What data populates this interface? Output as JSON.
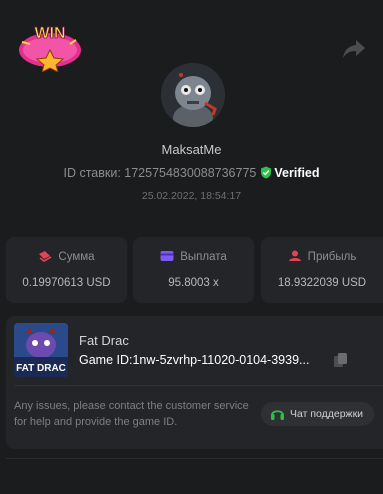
{
  "badge": {
    "text": "WIN"
  },
  "user": {
    "name": "MaksatMe"
  },
  "bet": {
    "id_label": "ID ставки: 1725754830088736775",
    "verified_label": "Verified",
    "datetime": "25.02.2022, 18:54:17"
  },
  "stats": [
    {
      "label": "Сумма",
      "value": "0.19970613 USD",
      "icon": "coins-icon",
      "color": "#e04455"
    },
    {
      "label": "Выплата",
      "value": "95.8003 x",
      "icon": "wallet-icon",
      "color": "#7c5cf0"
    },
    {
      "label": "Прибыль",
      "value": "18.9322039 USD",
      "icon": "profit-icon",
      "color": "#e04455"
    }
  ],
  "game": {
    "title": "Fat Drac",
    "thumb_label": "FAT DRAC",
    "id_line": "Game ID:1nw-5zvrhp-11020-0104-3939..."
  },
  "support": {
    "text": "Any issues, please contact the customer service for help and provide the game ID.",
    "button_label": "Чат поддержки"
  },
  "colors": {
    "verified": "#2bc24a",
    "support_icon": "#2bc24a",
    "background": "#1b1c1e",
    "card": "#232528"
  }
}
